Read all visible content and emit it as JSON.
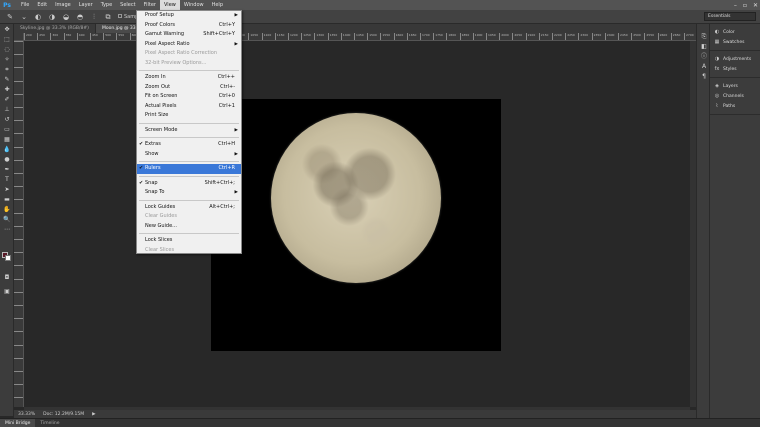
{
  "app": {
    "logo": "Ps"
  },
  "menubar": {
    "items": [
      "File",
      "Edit",
      "Image",
      "Layer",
      "Type",
      "Select",
      "Filter",
      "View",
      "Window",
      "Help"
    ],
    "active_index": 7
  },
  "window_controls": {
    "minimize": "–",
    "maximize": "▫",
    "close": "✕"
  },
  "options_bar": {
    "sample_label": "Sample All Layers",
    "workspace": "Essentials"
  },
  "doc_tabs": [
    {
      "label": "Skyline.jpg @ 33.3% (RGB/8#)",
      "active": false
    },
    {
      "label": "Moon.jpg @ 33.3",
      "active": true
    }
  ],
  "view_menu": [
    {
      "label": "Proof Setup",
      "shortcut": "",
      "submenu": true,
      "checked": false,
      "disabled": false
    },
    {
      "label": "Proof Colors",
      "shortcut": "Ctrl+Y",
      "submenu": false,
      "checked": false,
      "disabled": false
    },
    {
      "label": "Gamut Warning",
      "shortcut": "Shift+Ctrl+Y",
      "submenu": false,
      "checked": false,
      "disabled": false
    },
    {
      "label": "Pixel Aspect Ratio",
      "shortcut": "",
      "submenu": true,
      "checked": false,
      "disabled": false
    },
    {
      "label": "Pixel Aspect Ratio Correction",
      "shortcut": "",
      "submenu": false,
      "checked": false,
      "disabled": true
    },
    {
      "label": "32-bit Preview Options...",
      "shortcut": "",
      "submenu": false,
      "checked": false,
      "disabled": true
    },
    {
      "sep": true
    },
    {
      "label": "Zoom In",
      "shortcut": "Ctrl++",
      "submenu": false,
      "checked": false,
      "disabled": false
    },
    {
      "label": "Zoom Out",
      "shortcut": "Ctrl+-",
      "submenu": false,
      "checked": false,
      "disabled": false
    },
    {
      "label": "Fit on Screen",
      "shortcut": "Ctrl+0",
      "submenu": false,
      "checked": false,
      "disabled": false
    },
    {
      "label": "Actual Pixels",
      "shortcut": "Ctrl+1",
      "submenu": false,
      "checked": false,
      "disabled": false
    },
    {
      "label": "Print Size",
      "shortcut": "",
      "submenu": false,
      "checked": false,
      "disabled": false
    },
    {
      "sep": true
    },
    {
      "label": "Screen Mode",
      "shortcut": "",
      "submenu": true,
      "checked": false,
      "disabled": false
    },
    {
      "sep": true
    },
    {
      "label": "Extras",
      "shortcut": "Ctrl+H",
      "submenu": false,
      "checked": true,
      "disabled": false
    },
    {
      "label": "Show",
      "shortcut": "",
      "submenu": true,
      "checked": false,
      "disabled": false
    },
    {
      "sep": true
    },
    {
      "label": "Rulers",
      "shortcut": "Ctrl+R",
      "submenu": false,
      "checked": true,
      "disabled": false,
      "highlight": true
    },
    {
      "sep": true
    },
    {
      "label": "Snap",
      "shortcut": "Shift+Ctrl+;",
      "submenu": false,
      "checked": true,
      "disabled": false
    },
    {
      "label": "Snap To",
      "shortcut": "",
      "submenu": true,
      "checked": false,
      "disabled": false
    },
    {
      "sep": true
    },
    {
      "label": "Lock Guides",
      "shortcut": "Alt+Ctrl+;",
      "submenu": false,
      "checked": false,
      "disabled": false
    },
    {
      "label": "Clear Guides",
      "shortcut": "",
      "submenu": false,
      "checked": false,
      "disabled": true
    },
    {
      "label": "New Guide...",
      "shortcut": "",
      "submenu": false,
      "checked": false,
      "disabled": false
    },
    {
      "sep": true
    },
    {
      "label": "Lock Slices",
      "shortcut": "",
      "submenu": false,
      "checked": false,
      "disabled": false
    },
    {
      "label": "Clear Slices",
      "shortcut": "",
      "submenu": false,
      "checked": false,
      "disabled": true
    }
  ],
  "ruler_labels": [
    "200",
    "250",
    "300",
    "350",
    "400",
    "450",
    "500",
    "550",
    "600",
    "650",
    "700",
    "750",
    "800",
    "850",
    "900",
    "950",
    "1000",
    "1050",
    "1100",
    "1150",
    "1200",
    "1250",
    "1300",
    "1350",
    "1400",
    "1450",
    "1500",
    "1550",
    "1600",
    "1650",
    "1700",
    "1750",
    "1800",
    "1850",
    "1900",
    "1950",
    "2000",
    "2050",
    "2100",
    "2150",
    "2200",
    "2250",
    "2300",
    "2350",
    "2400",
    "2450",
    "2500",
    "2550",
    "2600",
    "2650",
    "2700"
  ],
  "status": {
    "zoom": "33.33%",
    "doc": "Doc: 12.2M/9.15M"
  },
  "bottom_tabs": [
    {
      "label": "Mini Bridge",
      "active": true
    },
    {
      "label": "Timeline",
      "active": false
    }
  ],
  "panels": [
    {
      "group": [
        {
          "icon": "color-icon",
          "label": "Color"
        },
        {
          "icon": "swatches-icon",
          "label": "Swatches"
        }
      ]
    },
    {
      "group": [
        {
          "icon": "adjustments-icon",
          "label": "Adjustments"
        },
        {
          "icon": "styles-icon",
          "label": "Styles"
        }
      ]
    },
    {
      "group": [
        {
          "icon": "layers-icon",
          "label": "Layers"
        },
        {
          "icon": "channels-icon",
          "label": "Channels"
        },
        {
          "icon": "paths-icon",
          "label": "Paths"
        }
      ]
    }
  ],
  "colors": {
    "foreground": "#5a1a28",
    "background": "#ffffff",
    "menu_highlight": "#3a78d8"
  }
}
